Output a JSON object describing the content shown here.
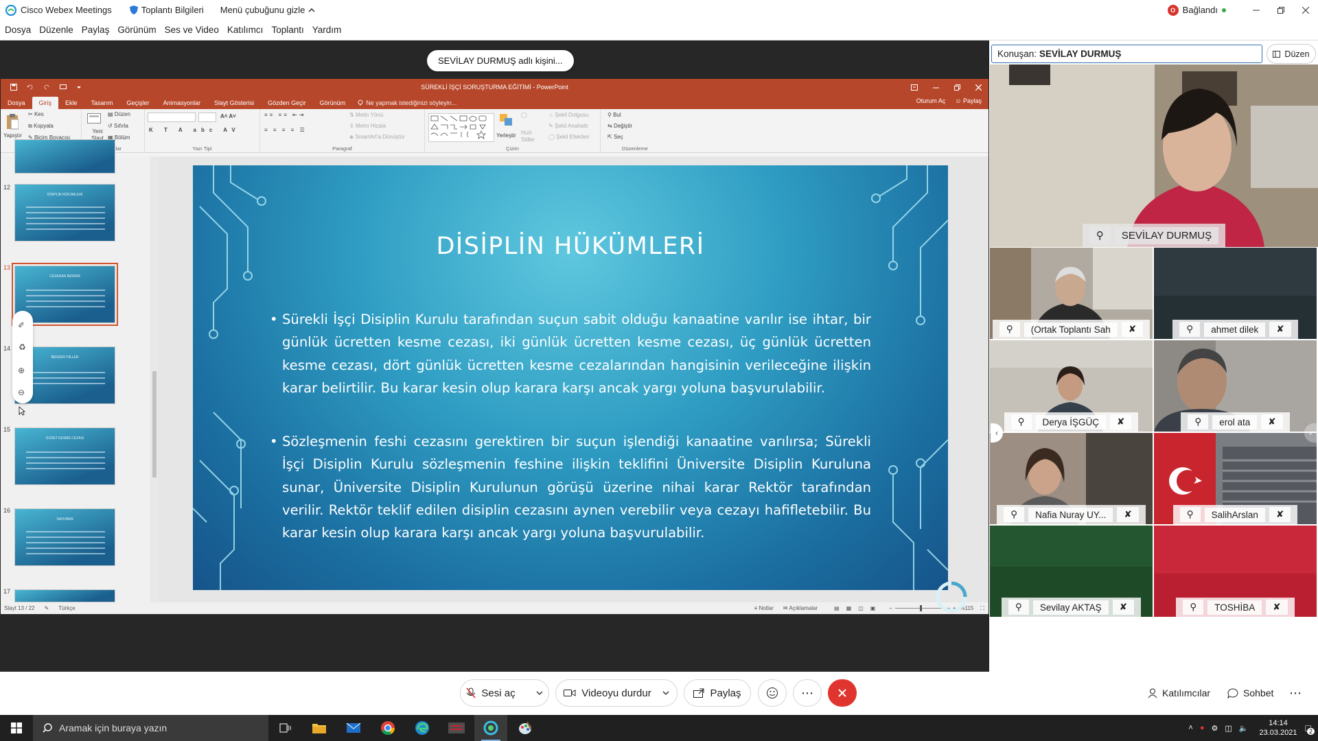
{
  "webex": {
    "app_title": "Cisco Webex Meetings",
    "meeting_info": "Toplantı Bilgileri",
    "hide_menu": "Menü çubuğunu gizle",
    "connection_status": "Bağlandı",
    "connection_badge": "O",
    "colors": {
      "accent": "#2f6fb0",
      "leave": "#e0352f",
      "connected": "#39a845"
    }
  },
  "menu": [
    "Dosya",
    "Düzenle",
    "Paylaş",
    "Görünüm",
    "Ses ve Video",
    "Katılımcı",
    "Toplantı",
    "Yardım"
  ],
  "sharing_pill": "SEVİLAY DURMUŞ adlı kişini...",
  "ppt": {
    "title": "SÜREKLİ İŞÇİ SORUŞTURMA EĞİTİMİ - PowerPoint",
    "tabs": [
      "Dosya",
      "Giriş",
      "Ekle",
      "Tasarım",
      "Geçişler",
      "Animasyonlar",
      "Slayt Gösterisi",
      "Gözden Geçir",
      "Görünüm"
    ],
    "tell_me": "Ne yapmak istediğinizi söyleyin...",
    "signin": "Oturum Aç",
    "share": "Paylaş",
    "ribbon": {
      "paste": "Yapıştır",
      "cut": "Kes",
      "copy": "Kopyala",
      "format_painter": "Biçim Boyacısı",
      "clipboard_group": "Pano",
      "new_slide": "Yeni Slayt",
      "layout": "Düzen",
      "reset": "Sıfırla",
      "section": "Bölüm",
      "slides_group": "Slaytlar",
      "font_group": "Yazı Tipi",
      "text_direction": "Metin Yönü",
      "align_text": "Metni Hizala",
      "smartart": "SmartArt'a Dönüştür",
      "paragraph_group": "Paragraf",
      "arrange": "Yerleştir",
      "quick_styles": "Hızlı Stiller",
      "shape_fill": "Şekil Dolgusu",
      "shape_outline": "Şekil Anahattı",
      "shape_effects": "Şekil Efektleri",
      "drawing_group": "Çizim",
      "find": "Bul",
      "replace": "Değiştir",
      "select": "Seç",
      "editing_group": "Düzenleme"
    },
    "thumbnails": [
      {
        "num": "12",
        "title": "DİSİPLİN HÜKÜMLERİ"
      },
      {
        "num": "13",
        "title": "CEZADAN İNDİRİM"
      },
      {
        "num": "14",
        "title": "BENZER FİİLLER"
      },
      {
        "num": "15",
        "title": "ÜCRET KESME CEZASI"
      },
      {
        "num": "16",
        "title": "SAVUNMA"
      },
      {
        "num": "17",
        "title": ""
      }
    ],
    "slide": {
      "title": "DİSİPLİN HÜKÜMLERİ",
      "bullets": [
        "Sürekli İşçi Disiplin Kurulu tarafından suçun sabit olduğu kanaatine varılır ise ihtar, bir günlük ücretten kesme cezası, iki günlük ücretten kesme cezası, üç günlük ücretten kesme cezası, dört günlük ücretten kesme cezalarından hangisinin verileceğine ilişkin karar belirtilir. Bu karar kesin olup karara karşı ancak yargı yoluna başvurulabilir.",
        "Sözleşmenin feshi cezasını gerektiren bir suçun işlendiği kanaatine varılırsa; Sürekli İşçi Disiplin Kurulu sözleşmenin feshine ilişkin teklifini Üniversite Disiplin Kuruluna sunar, Üniversite Disiplin Kurulunun görüşü üzerine nihai karar Rektör tarafından verilir. Rektör teklif edilen disiplin cezasını aynen verebilir veya cezayı hafifletebilir. Bu karar kesin olup karara karşı ancak yargı yoluna başvurulabilir."
      ]
    },
    "status": {
      "slide_counter": "Slayt 13 / 22",
      "language": "Türkçe",
      "notes": "Notlar",
      "comments": "Açıklamalar",
      "zoom": "%115"
    }
  },
  "panel": {
    "speaker_label": "Konuşan:",
    "speaker_name": "SEVİLAY DURMUŞ",
    "layout_btn": "Düzen",
    "main_participant": "SEVİLAY DURMUŞ",
    "participants": [
      {
        "name": "(Ortak Toplantı Sah",
        "bg": "#8e8a82"
      },
      {
        "name": "ahmet dilek",
        "bg": "#2e3a3f"
      },
      {
        "name": "Derya İŞGÜÇ",
        "bg": "#bcb6ad"
      },
      {
        "name": "erol ata",
        "bg": "#8d8a85"
      },
      {
        "name": "Nafia Nuray UY...",
        "bg": "#9c8e82"
      },
      {
        "name": "SalihArslan",
        "bg": "#7a7d82"
      },
      {
        "name": "Sevilay AKTAŞ",
        "bg": "#1f4a28"
      },
      {
        "name": "TOSHİBA",
        "bg": "#c9283a"
      }
    ]
  },
  "controls": {
    "unmute": "Sesi aç",
    "stop_video": "Videoyu durdur",
    "share": "Paylaş",
    "participants": "Katılımcılar",
    "chat": "Sohbet"
  },
  "taskbar": {
    "search_placeholder": "Aramak için buraya yazın",
    "time": "14:14",
    "date": "23.03.2021",
    "notification_count": "2"
  }
}
